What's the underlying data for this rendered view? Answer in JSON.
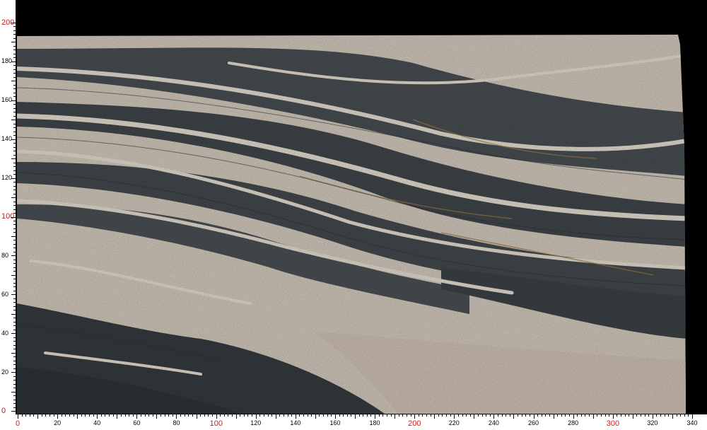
{
  "photo": {
    "subject": "marble slab with dark grey and cream veining",
    "colors": {
      "background": "#000000",
      "ruler": "#ffffff",
      "major_label": "#d01818",
      "marble_light": "#cfc5b9",
      "marble_dark": "#3e4448",
      "vein_rust": "#a07846"
    }
  },
  "ruler_left": {
    "labels": [
      "0",
      "20",
      "40",
      "60",
      "80",
      "100",
      "120",
      "140",
      "160",
      "180",
      "200"
    ],
    "values": [
      0,
      20,
      40,
      60,
      80,
      100,
      120,
      140,
      160,
      180,
      200
    ]
  },
  "ruler_bottom": {
    "labels": [
      "0",
      "20",
      "40",
      "60",
      "80",
      "100",
      "120",
      "140",
      "160",
      "180",
      "200",
      "220",
      "240",
      "260",
      "280",
      "300",
      "320",
      "340"
    ],
    "values": [
      0,
      20,
      40,
      60,
      80,
      100,
      120,
      140,
      160,
      180,
      200,
      220,
      240,
      260,
      280,
      300,
      320,
      340
    ]
  }
}
